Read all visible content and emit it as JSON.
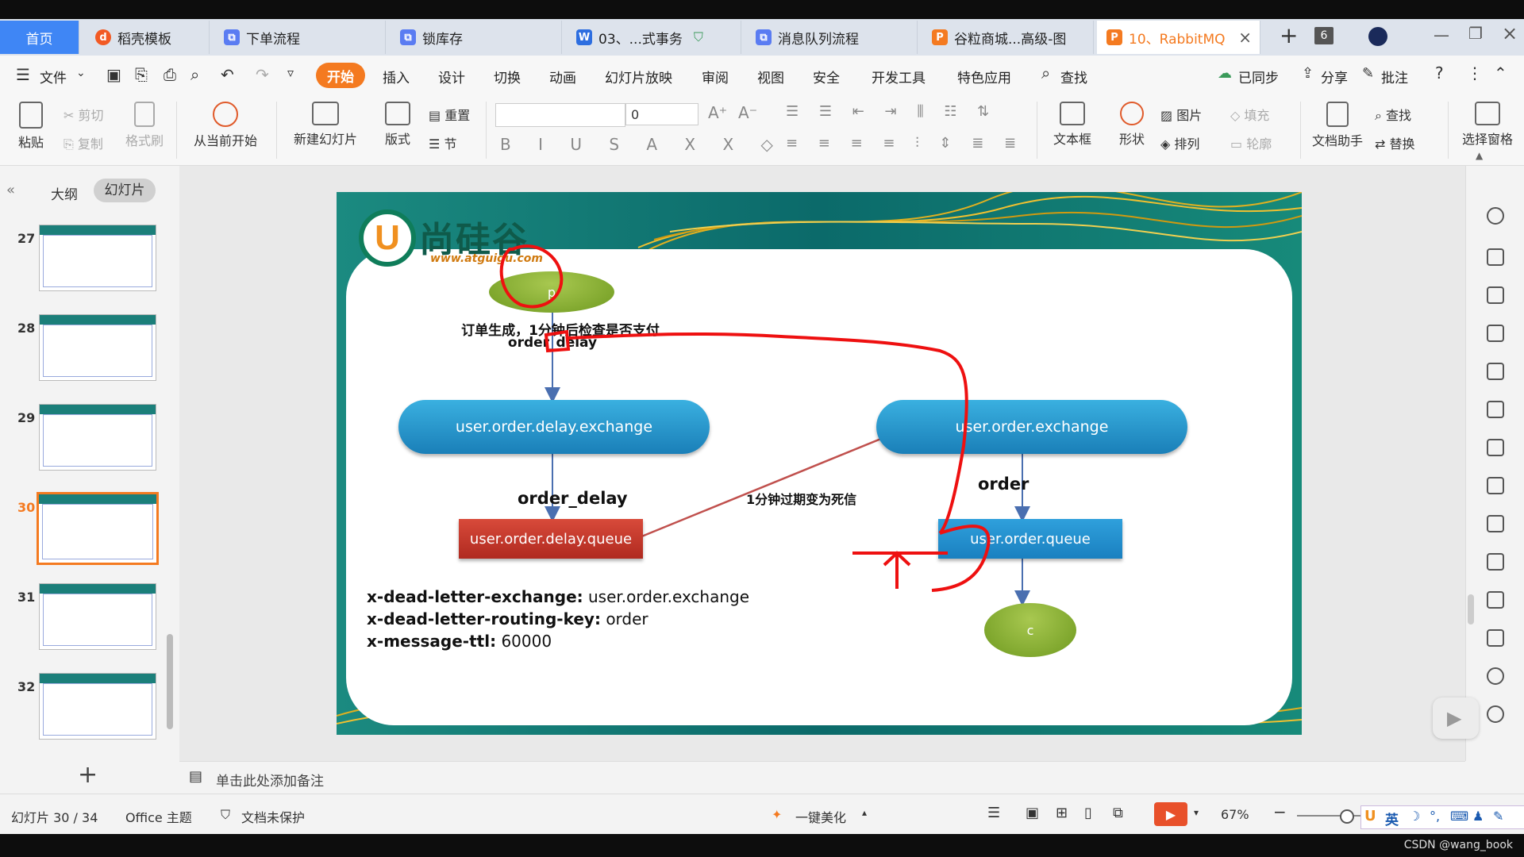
{
  "tabs": [
    {
      "label": "首页"
    },
    {
      "label": "稻壳模板"
    },
    {
      "label": "下单流程"
    },
    {
      "label": "锁库存"
    },
    {
      "label": "03、...式事务"
    },
    {
      "label": "消息队列流程"
    },
    {
      "label": "谷粒商城...高级-图"
    },
    {
      "label": "10、RabbitMQ"
    }
  ],
  "tab_count": "6",
  "menu": {
    "file": "文件",
    "items": [
      "开始",
      "插入",
      "设计",
      "切换",
      "动画",
      "幻灯片放映",
      "审阅",
      "视图",
      "安全",
      "开发工具",
      "特色应用"
    ],
    "search": "查找",
    "synced": "已同步",
    "share": "分享",
    "comment": "批注"
  },
  "ribbon": {
    "paste": "粘贴",
    "cut": "剪切",
    "copy": "复制",
    "format_painter": "格式刷",
    "play_from_current": "从当前开始",
    "new_slide": "新建幻灯片",
    "layout": "版式",
    "reset": "重置",
    "section": "节",
    "font_size": "0",
    "textbox": "文本框",
    "shape": "形状",
    "picture": "图片",
    "arrange": "排列",
    "fill": "填充",
    "outline": "轮廓",
    "doc_assistant": "文档助手",
    "find": "查找",
    "replace": "替换",
    "select_pane": "选择窗格"
  },
  "left_panel": {
    "outline_tab": "大纲",
    "slides_tab": "幻灯片",
    "thumbs": [
      {
        "num": "27"
      },
      {
        "num": "28"
      },
      {
        "num": "29"
      },
      {
        "num": "30"
      },
      {
        "num": "31"
      },
      {
        "num": "32"
      }
    ]
  },
  "slide": {
    "logo_text": "尚硅谷",
    "logo_url": "www.atguigu.com",
    "producer": "p",
    "consumer": "c",
    "note_top": "订单生成，1分钟后检查是否支付",
    "note_routing_top": "order_delay",
    "delay_exchange": "user.order.delay.exchange",
    "order_exchange": "user.order.exchange",
    "label_order_delay": "order_delay",
    "label_order": "order",
    "delay_queue": "user.order.delay.queue",
    "order_queue": "user.order.queue",
    "arrow_label": "1分钟过期变为死信",
    "args": [
      {
        "key": "x-dead-letter-exchange:",
        "value": "user.order.exchange"
      },
      {
        "key": "x-dead-letter-routing-key:",
        "value": "order"
      },
      {
        "key": "x-message-ttl:",
        "value": "60000"
      }
    ]
  },
  "notes_placeholder": "单击此处添加备注",
  "status": {
    "slide_info": "幻灯片 30 / 34",
    "theme": "Office 主题",
    "protect": "文档未保护",
    "beautify": "一键美化",
    "zoom": "67%",
    "ime": "英",
    "watermark": "CSDN @wang_book"
  }
}
